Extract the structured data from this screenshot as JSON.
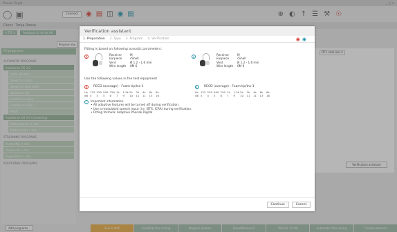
{
  "titlebar": {
    "left": "Phonak Target",
    "right": "_ □ ✕"
  },
  "toolbar": {
    "connect_label": "Connect"
  },
  "client": {
    "label": "Client",
    "name": "Tanja Roese"
  },
  "nav": {
    "back_label": "< TG >",
    "feedback_label": "Feedback & ind.lst fitt"
  },
  "program_mode_label": "Program mo",
  "left_panel": {
    "all_programs": "All programs",
    "section_auto": "AUTOMATIC PROGRAMS",
    "items": [
      "AutoSense OS 3.0",
      "Calm situation",
      "Speech in noise",
      "Speech in loud noise",
      "Speech in car",
      "Comfort in noise",
      "Comfort in echo",
      "Music",
      "AutoSense OS 3.0 (streaming)",
      "Media speech + mic",
      "Media music + mic"
    ],
    "section_stream": "STREAMING PROGRAMS",
    "stream_items": [
      "PartnerMic + mic",
      "Phone call + mic",
      "RogerDirect + mic"
    ],
    "section_add": "ADDITIONAL PROGRAMS",
    "add_programs": "Add programs..."
  },
  "right_area": {
    "label": "RTL real ear ▾",
    "verify_label": "Verification assistant"
  },
  "bottom_tabs": [
    {
      "label": "Gain & MPO",
      "active": true
    },
    {
      "label": "Audibility fine tuning"
    },
    {
      "label": "Program options"
    },
    {
      "label": "SoundRecover2"
    },
    {
      "label": "TK/Gain 35 dB"
    },
    {
      "label": "Automatic fine tuning"
    },
    {
      "label": "Tinnitus balance"
    }
  ],
  "modal": {
    "title": "Verification assistant",
    "steps": [
      "1. Preparation",
      "2. Type",
      "3. Program",
      "4. Verification"
    ],
    "fitting_text": "Fitting is based on following acoustic parameters:",
    "right_params": {
      "labels": [
        "Receiver",
        "Earpiece",
        "Vent",
        "Wire length"
      ],
      "values": [
        "M",
        "cShell",
        "Ø 1.2 - 1.6 mm",
        "0M 6"
      ]
    },
    "left_params": {
      "labels": [
        "Receiver",
        "Earpiece",
        "Vent",
        "Wire length"
      ],
      "values": [
        "M",
        "cShell",
        "Ø 1.2 - 1.6 mm",
        "0M 6"
      ]
    },
    "values_title": "Use the following values in the test equipment",
    "recd_right_title": "RECD (average) - Foam tip/Ins-1",
    "recd_left_title": "RECD (average) - Foam tip/Ins-1",
    "recd_right": {
      "hz_label": "Hz",
      "hz": [
        "125",
        "250",
        "500",
        "750",
        "1k",
        "1.5k",
        "2k",
        "3k",
        "4k",
        "6k",
        "8k"
      ],
      "db_label": "dB",
      "db": [
        "5",
        "5",
        "5",
        "6",
        "7",
        "9",
        "10",
        "11",
        "11",
        "13",
        "16"
      ]
    },
    "recd_left": {
      "hz_label": "Hz",
      "hz": [
        "125",
        "250",
        "500",
        "750",
        "1k",
        "1.5k",
        "2k",
        "3k",
        "4k",
        "6k",
        "8k"
      ],
      "db_label": "dB",
      "db": [
        "5",
        "5",
        "5",
        "6",
        "7",
        "9",
        "10",
        "11",
        "11",
        "13",
        "16"
      ]
    },
    "info_title": "Important information",
    "info_lines": [
      "• All adaptive features will be turned off during verification.",
      "• Use a modulated speech input (i.e. ISTS, ICRA) during verification.",
      "• Fitting formula: Adaptive Phonak Digital"
    ],
    "continue_label": "Continue",
    "cancel_label": "Cancel"
  },
  "colors": {
    "accent_green": "#9cb8a6",
    "right_ear": "#d43c2c",
    "left_ear": "#1a8fa8",
    "active_tab": "#e9a93a"
  }
}
